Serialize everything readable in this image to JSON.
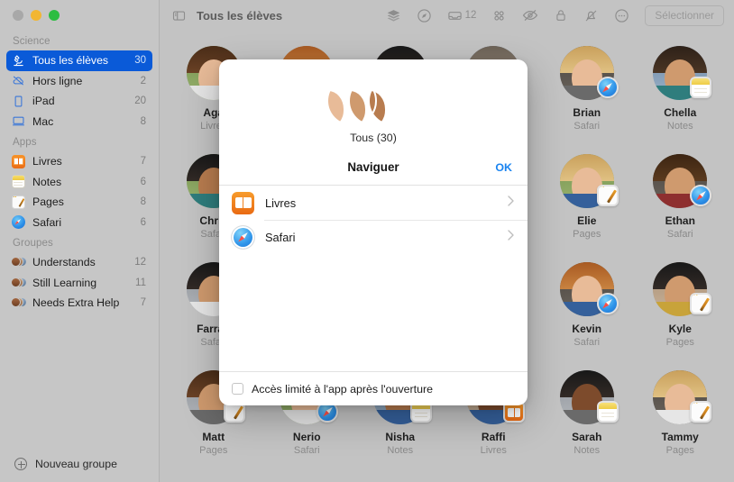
{
  "window": {
    "traffic_lights": [
      "close",
      "minimize",
      "zoom"
    ]
  },
  "sidebar": {
    "sections": [
      {
        "title": "Science",
        "items": [
          {
            "label": "Tous les élèves",
            "count": "30",
            "icon": "microscope-icon",
            "selected": true
          },
          {
            "label": "Hors ligne",
            "count": "2",
            "icon": "cloud-slash-icon",
            "selected": false
          },
          {
            "label": "iPad",
            "count": "20",
            "icon": "ipad-icon",
            "selected": false
          },
          {
            "label": "Mac",
            "count": "8",
            "icon": "mac-icon",
            "selected": false
          }
        ]
      },
      {
        "title": "Apps",
        "items": [
          {
            "label": "Livres",
            "count": "7",
            "icon": "books-app-icon",
            "selected": false
          },
          {
            "label": "Notes",
            "count": "6",
            "icon": "notes-app-icon",
            "selected": false
          },
          {
            "label": "Pages",
            "count": "8",
            "icon": "pages-app-icon",
            "selected": false
          },
          {
            "label": "Safari",
            "count": "6",
            "icon": "safari-app-icon",
            "selected": false
          }
        ]
      },
      {
        "title": "Groupes",
        "items": [
          {
            "label": "Understands",
            "count": "12",
            "icon": "group-avatars-icon",
            "selected": false
          },
          {
            "label": "Still Learning",
            "count": "11",
            "icon": "group-avatars-icon",
            "selected": false
          },
          {
            "label": "Needs Extra Help",
            "count": "7",
            "icon": "group-avatars-icon",
            "selected": false
          }
        ]
      }
    ],
    "new_group_label": "Nouveau groupe",
    "new_group_icon": "plus-circle-icon"
  },
  "toolbar": {
    "sidebar_toggle_icon": "sidebar-icon",
    "title": "Tous les élèves",
    "icons": [
      {
        "name": "layers-icon",
        "badge": ""
      },
      {
        "name": "navigate-icon",
        "badge": ""
      },
      {
        "name": "inbox-tray-icon",
        "badge": "12"
      },
      {
        "name": "grid-apps-icon",
        "badge": ""
      },
      {
        "name": "eye-slash-icon",
        "badge": ""
      },
      {
        "name": "lock-icon",
        "badge": ""
      },
      {
        "name": "bell-slash-icon",
        "badge": ""
      },
      {
        "name": "more-ellipsis-icon",
        "badge": ""
      }
    ],
    "select_button": "Sélectionner"
  },
  "students": [
    {
      "name": "Aga",
      "app": "Livres",
      "badge": "books",
      "bg": "bg-green",
      "hair": "hair-brown",
      "skin": "skin-light",
      "top": "top-white"
    },
    {
      "name": "",
      "app": "",
      "badge": "",
      "bg": "bg-warm",
      "hair": "hair-red",
      "skin": "skin-light",
      "top": "top-blue"
    },
    {
      "name": "",
      "app": "",
      "badge": "",
      "bg": "bg-grey",
      "hair": "hair-black",
      "skin": "skin-tan",
      "top": "top-grey"
    },
    {
      "name": "",
      "app": "",
      "badge": "",
      "bg": "bg-blue",
      "hair": "hair-grey",
      "skin": "skin-light",
      "top": "top-blue"
    },
    {
      "name": "Brian",
      "app": "Safari",
      "badge": "safari",
      "bg": "bg-dark",
      "hair": "hair-blonde",
      "skin": "skin-light",
      "top": "top-grey"
    },
    {
      "name": "Chella",
      "app": "Notes",
      "badge": "notes",
      "bg": "bg-blue",
      "hair": "hair-dark",
      "skin": "skin-med",
      "top": "top-teal"
    },
    {
      "name": "Chris",
      "app": "Safari",
      "badge": "safari",
      "bg": "bg-green",
      "hair": "hair-black",
      "skin": "skin-tan",
      "top": "top-teal"
    },
    {
      "name": "",
      "app": "",
      "badge": "",
      "bg": "bg-grey",
      "hair": "hair-brown",
      "skin": "skin-light",
      "top": "top-white"
    },
    {
      "name": "",
      "app": "",
      "badge": "",
      "bg": "bg-warm",
      "hair": "hair-dark",
      "skin": "skin-med",
      "top": "top-red"
    },
    {
      "name": "",
      "app": "",
      "badge": "",
      "bg": "bg-blue",
      "hair": "hair-black",
      "skin": "skin-deep",
      "top": "top-yellow"
    },
    {
      "name": "Elie",
      "app": "Pages",
      "badge": "pages",
      "bg": "bg-green",
      "hair": "hair-blonde",
      "skin": "skin-light",
      "top": "top-blue"
    },
    {
      "name": "Ethan",
      "app": "Safari",
      "badge": "safari",
      "bg": "bg-dark",
      "hair": "hair-curly",
      "skin": "skin-med",
      "top": "top-red"
    },
    {
      "name": "Farrah",
      "app": "Safari",
      "badge": "",
      "bg": "bg-grey",
      "hair": "hair-black",
      "skin": "skin-med",
      "top": "top-white"
    },
    {
      "name": "",
      "app": "",
      "badge": "",
      "bg": "bg-warm",
      "hair": "hair-brown",
      "skin": "skin-light",
      "top": "top-grey"
    },
    {
      "name": "",
      "app": "",
      "badge": "",
      "bg": "bg-blue",
      "hair": "hair-dark",
      "skin": "skin-tan",
      "top": "top-blue"
    },
    {
      "name": "",
      "app": "",
      "badge": "",
      "bg": "bg-green",
      "hair": "hair-black",
      "skin": "skin-deep",
      "top": "top-teal"
    },
    {
      "name": "Kevin",
      "app": "Safari",
      "badge": "safari",
      "bg": "bg-dark",
      "hair": "hair-red",
      "skin": "skin-light",
      "top": "top-blue"
    },
    {
      "name": "Kyle",
      "app": "Pages",
      "badge": "pages",
      "bg": "bg-warm",
      "hair": "hair-black",
      "skin": "skin-med",
      "top": "top-yellow"
    },
    {
      "name": "Matt",
      "app": "Pages",
      "badge": "pages",
      "bg": "bg-grey",
      "hair": "hair-brown",
      "skin": "skin-med",
      "top": "top-grey"
    },
    {
      "name": "Nerio",
      "app": "Safari",
      "badge": "safari",
      "bg": "bg-green",
      "hair": "hair-brown",
      "skin": "skin-light",
      "top": "top-white"
    },
    {
      "name": "Nisha",
      "app": "Notes",
      "badge": "notes",
      "bg": "bg-blue",
      "hair": "hair-dark",
      "skin": "skin-tan",
      "top": "top-blue"
    },
    {
      "name": "Raffi",
      "app": "Livres",
      "badge": "books",
      "bg": "bg-warm",
      "hair": "hair-black",
      "skin": "skin-deep",
      "top": "top-blue"
    },
    {
      "name": "Sarah",
      "app": "Notes",
      "badge": "notes",
      "bg": "bg-grey",
      "hair": "hair-black",
      "skin": "skin-deep",
      "top": "top-grey"
    },
    {
      "name": "Tammy",
      "app": "Pages",
      "badge": "pages",
      "bg": "bg-dark",
      "hair": "hair-blonde",
      "skin": "skin-light",
      "top": "top-white"
    }
  ],
  "modal": {
    "avatars": [
      {
        "bg": "bg-warm",
        "hair": "hair-dark",
        "skin": "skin-med",
        "top": "top-blue"
      },
      {
        "bg": "bg-blue",
        "hair": "hair-black",
        "skin": "skin-tan",
        "top": "top-grey"
      },
      {
        "bg": "bg-green",
        "hair": "hair-blonde",
        "skin": "skin-light",
        "top": "top-white"
      }
    ],
    "group_label": "Tous (30)",
    "action_title": "Naviguer",
    "ok_label": "OK",
    "apps": [
      {
        "label": "Livres",
        "icon": "books-app-icon",
        "chevron": "chevron-right-icon"
      },
      {
        "label": "Safari",
        "icon": "safari-app-icon",
        "chevron": "chevron-right-icon"
      }
    ],
    "footer_checkbox_label": "Accès limité à l'app après l'ouverture",
    "footer_checkbox_checked": false
  },
  "colors": {
    "accent_blue": "#1a84f0",
    "sidebar_selected": "#0a5ad8",
    "window_bg": "#c3c3c3",
    "sidebar_bg": "#c6c6c6"
  }
}
